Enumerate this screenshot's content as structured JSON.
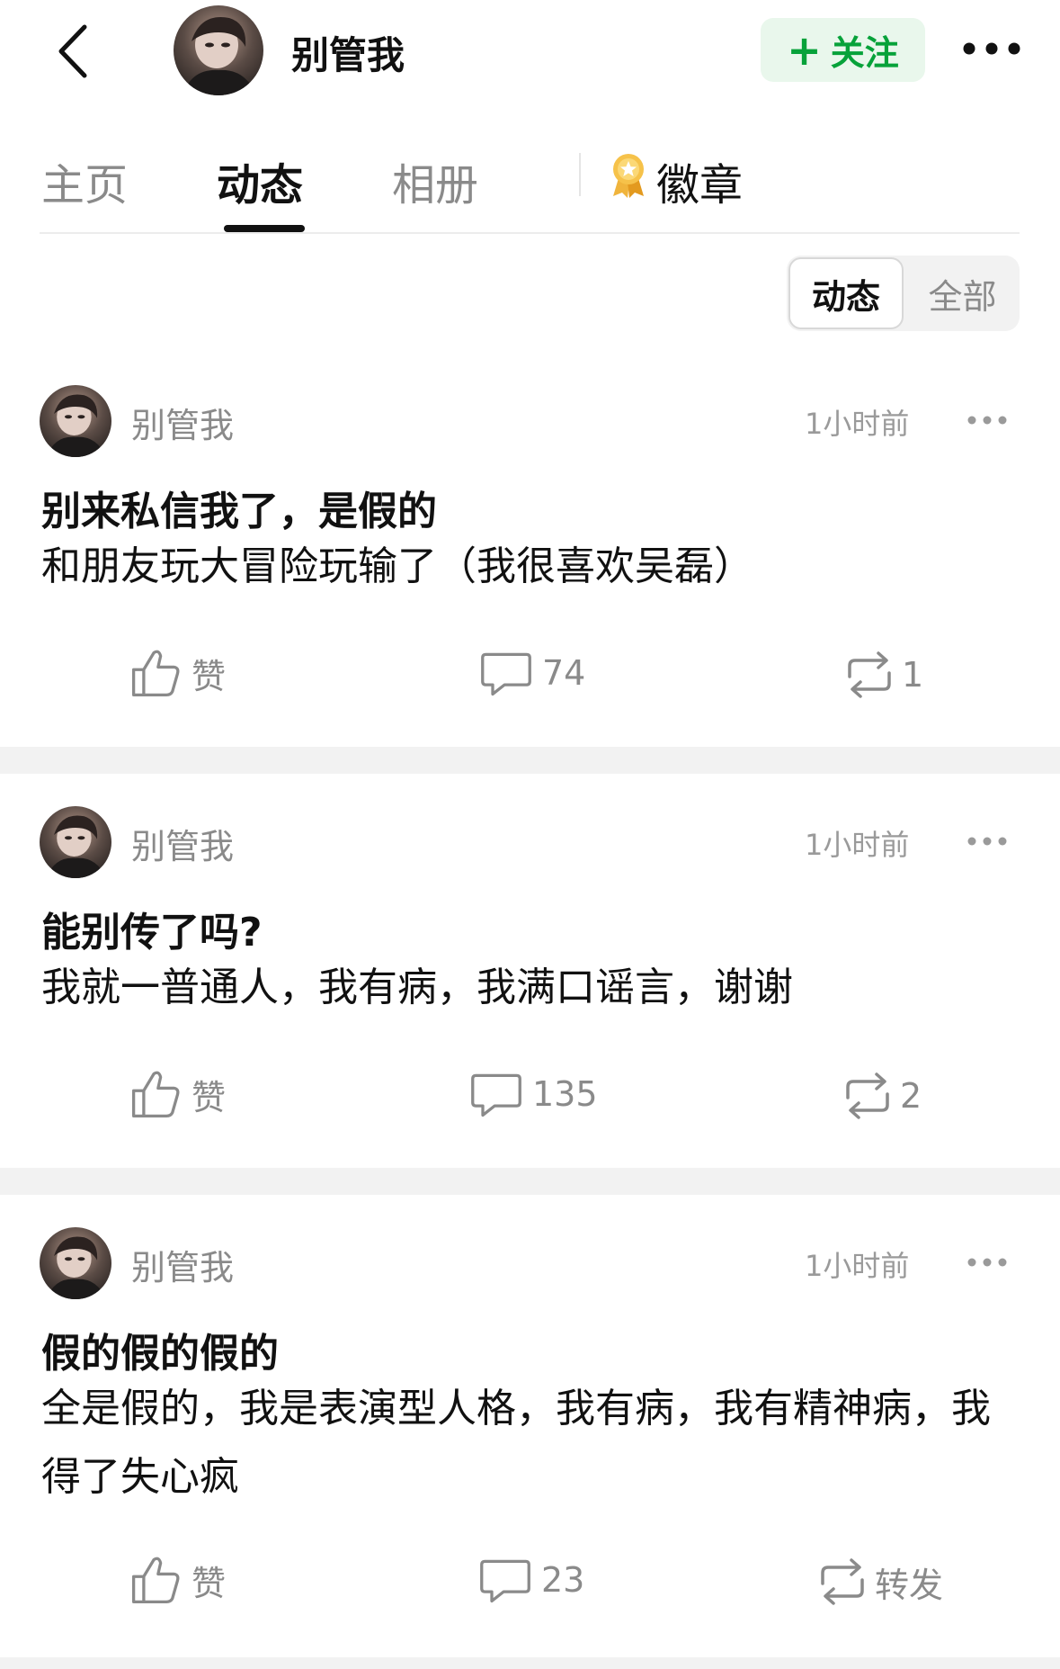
{
  "header": {
    "name": "别管我",
    "follow_label": "关注"
  },
  "tabs": {
    "home": "主页",
    "moments": "动态",
    "album": "相册",
    "badges": "徽章"
  },
  "filter": {
    "active": "动态",
    "all": "全部"
  },
  "posts": [
    {
      "author": "别管我",
      "time": "1小时前",
      "title": "别来私信我了，是假的",
      "body": "和朋友玩大冒险玩输了（我很喜欢吴磊）",
      "like_label": "赞",
      "comments": "74",
      "reposts": "1"
    },
    {
      "author": "别管我",
      "time": "1小时前",
      "title": "能别传了吗?",
      "body": "我就一普通人，我有病，我满口谣言，谢谢",
      "like_label": "赞",
      "comments": "135",
      "reposts": "2"
    },
    {
      "author": "别管我",
      "time": "1小时前",
      "title": "假的假的假的",
      "body": "全是假的，我是表演型人格，我有病，我有精神病，我得了失心疯",
      "like_label": "赞",
      "comments": "23",
      "reposts": "转发"
    }
  ],
  "colors": {
    "accent_green": "#07a23a",
    "follow_bg": "#e9f7ec",
    "muted_text": "#8a8a8a",
    "separator": "#f2f2f2"
  },
  "icons": [
    "back-arrow-icon",
    "plus-icon",
    "more-icon",
    "medal-icon",
    "thumbs-up-icon",
    "comment-icon",
    "repost-icon"
  ]
}
